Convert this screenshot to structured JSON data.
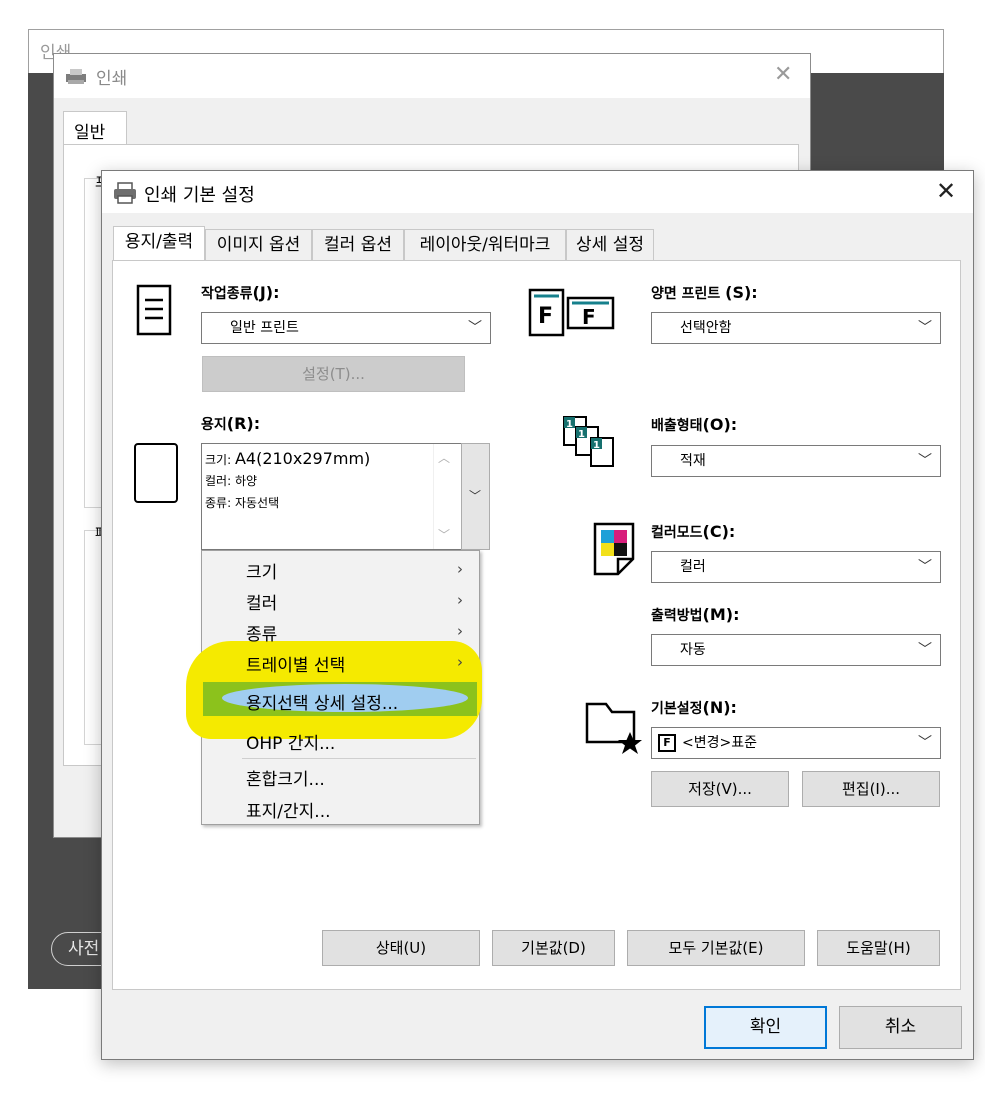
{
  "back_window": {
    "title": "인쇄",
    "pill_label": "사전"
  },
  "mid_window": {
    "title": "인쇄",
    "tab": "일반",
    "group1_label": "프",
    "group2_label": "페"
  },
  "dialog": {
    "title": "인쇄 기본 설정",
    "tabs": [
      "용지/출력",
      "이미지 옵션",
      "컬러 옵션",
      "레이아웃/워터마크",
      "상세 설정"
    ],
    "job_type": {
      "label": "작업종류",
      "key": "(J):",
      "value": "일반 프린트",
      "settings_button": "설정(T)..."
    },
    "paper": {
      "label": "용지",
      "key": "(R):",
      "size_label": "크기:",
      "size_value": "A4(210x297mm)",
      "color_label": "컬러:",
      "color_value": "하양",
      "type_label": "종류:",
      "type_value": "자동선택"
    },
    "duplex": {
      "label": "양면 프린트",
      "key": "(S):",
      "value": "선택안함"
    },
    "output": {
      "label": "배출형태",
      "key": "(O):",
      "value": "적재"
    },
    "color_mode": {
      "label": "컬러모드",
      "key": "(C):",
      "value": "컬러"
    },
    "output_method": {
      "label": "출력방법",
      "key": "(M):",
      "value": "자동"
    },
    "preset": {
      "label": "기본설정",
      "key": "(N):",
      "badge": "F",
      "value": "<변경>표준",
      "save_button": "저장(V)...",
      "edit_button": "편집(I)..."
    },
    "bottom_buttons": {
      "status": "상태(U)",
      "default": "기본값(D)",
      "all_default": "모두 기본값(E)",
      "help": "도움말(H)"
    },
    "ok": "확인",
    "cancel": "취소"
  },
  "context_menu": {
    "items": [
      {
        "label": "크기",
        "submenu": true
      },
      {
        "label": "컬러",
        "submenu": true
      },
      {
        "label": "종류",
        "submenu": true
      },
      {
        "label": "트레이별 선택",
        "submenu": true
      },
      {
        "label": "용지선택 상세 설정...",
        "submenu": false,
        "highlighted": true
      },
      {
        "label": "OHP 간지...",
        "submenu": false
      },
      {
        "label": "혼합크기...",
        "submenu": false
      },
      {
        "label": "표지/간지...",
        "submenu": false
      }
    ],
    "highlight_color": "#f5ea00"
  }
}
